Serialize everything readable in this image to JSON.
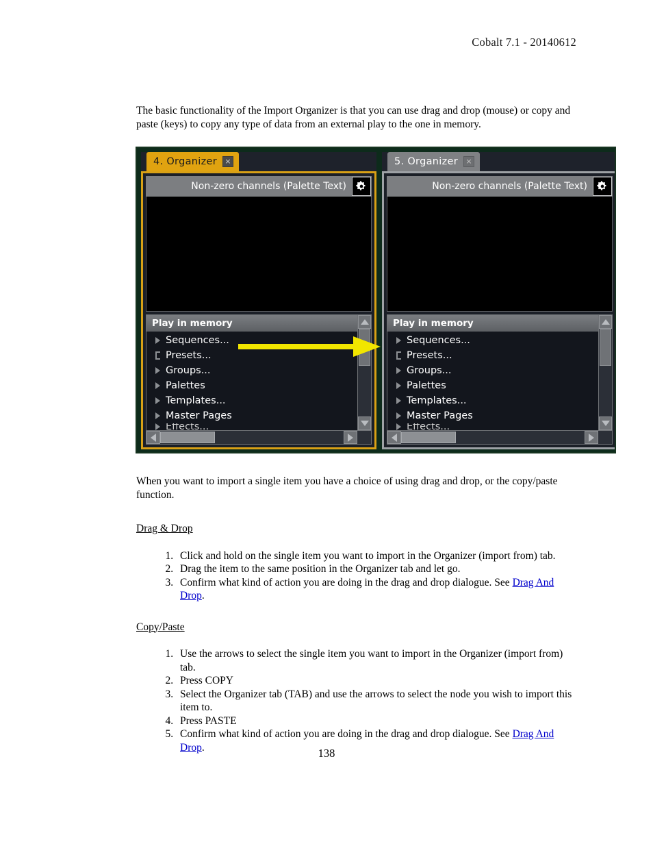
{
  "document": {
    "header": "Cobalt 7.1 - 20140612",
    "page_number": "138",
    "intro_paragraph": "The basic functionality of the Import Organizer is that you can use drag and drop (mouse) or copy and paste (keys) to copy any type of data from an external play to the one in memory.",
    "second_paragraph": "When you want to import a single item you have a choice of using drag and drop, or the copy/paste function.",
    "sections": [
      {
        "heading": "Drag & Drop",
        "steps": [
          {
            "text": "Click and hold on the single item you want to import in the Organizer (import from) tab.",
            "link": "",
            "tail": ""
          },
          {
            "text": "Drag the item to the same position in the Organizer tab and let go.",
            "link": "",
            "tail": ""
          },
          {
            "text": "Confirm what kind of action you are doing in the drag and drop dialogue. See ",
            "link": "Drag And Drop",
            "tail": "."
          }
        ]
      },
      {
        "heading": "Copy/Paste",
        "steps": [
          {
            "text": "Use the arrows to select the single item you want to import in the Organizer (import from) tab.",
            "link": "",
            "tail": ""
          },
          {
            "text": "Press COPY",
            "link": "",
            "tail": ""
          },
          {
            "text": "Select the Organizer tab (TAB) and use the arrows to select the node you wish to import this item to.",
            "link": "",
            "tail": ""
          },
          {
            "text": "Press PASTE",
            "link": "",
            "tail": ""
          },
          {
            "text": "Confirm what kind of action you are doing in the drag and drop dialogue. See ",
            "link": "Drag And Drop",
            "tail": "."
          }
        ]
      }
    ]
  },
  "figure": {
    "colors": {
      "outer_background": "#0d2b1b",
      "active_accent": "#d9a116",
      "inactive_accent": "#9ea2a6",
      "tab_active": "#e0a310",
      "tab_inactive": "#7f8184",
      "canvas": "#000000",
      "arrow": "#f2e600"
    },
    "arrow": {
      "name": "drag-direction-arrow",
      "color": "#f2e600",
      "direction": "right"
    },
    "panels": [
      {
        "id": "left",
        "state": "active",
        "tab": {
          "label": "4. Organizer",
          "close_label": "×"
        },
        "title_bar": {
          "text": "Non-zero channels (Palette Text)",
          "gear_icon": "gear-icon"
        },
        "tree": {
          "header": "Play in memory",
          "items": [
            {
              "label": "Sequences...",
              "bullet": "triangle"
            },
            {
              "label": "Presets...",
              "bullet": "tee"
            },
            {
              "label": "Groups...",
              "bullet": "triangle"
            },
            {
              "label": "Palettes",
              "bullet": "triangle"
            },
            {
              "label": "Templates...",
              "bullet": "triangle"
            },
            {
              "label": "Master Pages",
              "bullet": "triangle"
            },
            {
              "label": "Effects...",
              "bullet": "triangle"
            }
          ]
        }
      },
      {
        "id": "right",
        "state": "inactive",
        "tab": {
          "label": "5. Organizer",
          "close_label": "×"
        },
        "title_bar": {
          "text": "Non-zero channels (Palette Text)",
          "gear_icon": "gear-icon"
        },
        "tree": {
          "header": "Play in memory",
          "items": [
            {
              "label": "Sequences...",
              "bullet": "triangle"
            },
            {
              "label": "Presets...",
              "bullet": "tee"
            },
            {
              "label": "Groups...",
              "bullet": "triangle"
            },
            {
              "label": "Palettes",
              "bullet": "triangle"
            },
            {
              "label": "Templates...",
              "bullet": "triangle"
            },
            {
              "label": "Master Pages",
              "bullet": "triangle"
            },
            {
              "label": "Effects...",
              "bullet": "triangle"
            }
          ]
        }
      }
    ]
  }
}
